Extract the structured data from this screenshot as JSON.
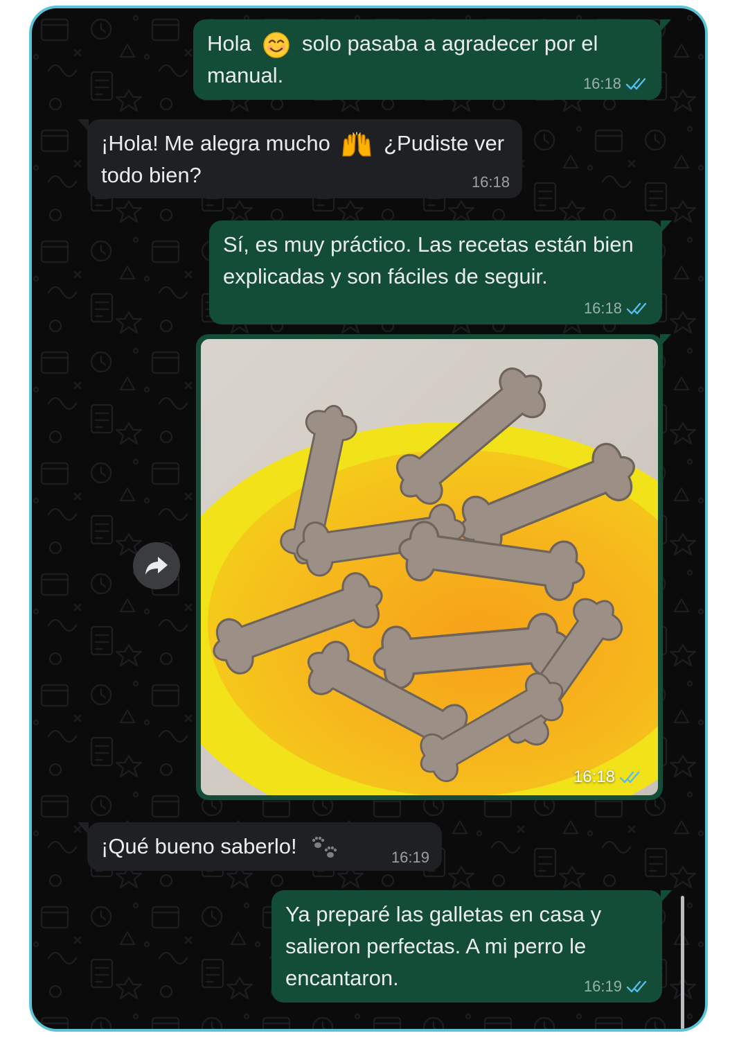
{
  "colors": {
    "frame": "#5cc3d6",
    "background": "#0b0b0c",
    "outgoing_bubble": "#144d37",
    "incoming_bubble": "#1f2023",
    "read_ticks": "#53bdeb"
  },
  "messages": [
    {
      "direction": "out",
      "text_before": "Hola",
      "emoji": "smiling-face-icon",
      "text_after": "solo pasaba a agradecer por el manual.",
      "time": "16:18",
      "status": "read"
    },
    {
      "direction": "in",
      "text_before": "¡Hola! Me alegra mucho",
      "emoji": "raising-hands-icon",
      "text_after": "¿Pudiste ver todo bien?",
      "time": "16:18"
    },
    {
      "direction": "out",
      "text": "Sí, es muy práctico. Las recetas están bien explicadas y son fáciles de seguir.",
      "time": "16:18",
      "status": "read"
    },
    {
      "direction": "out",
      "type": "image",
      "image": "dog-biscuit-bones-in-yellow-bowl",
      "time": "16:18",
      "status": "read"
    },
    {
      "direction": "in",
      "text": "¡Qué bueno saberlo!",
      "emoji": "paw-prints-icon",
      "time": "16:19"
    },
    {
      "direction": "out",
      "text": "Ya preparé las galletas en casa y salieron perfectas. A mi perro le encantaron.",
      "time": "16:19",
      "status": "read"
    }
  ],
  "forward_button": {
    "icon": "forward-arrow-icon"
  }
}
